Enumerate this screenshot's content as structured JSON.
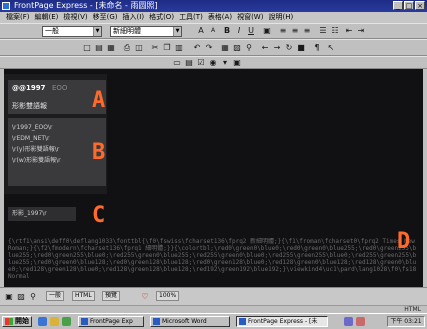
{
  "window": {
    "title": "FrontPage Express - [未命名 - 雨圆照]"
  },
  "menu": [
    "檔案(F)",
    "編輯(E)",
    "檢視(V)",
    "移至(G)",
    "插入(I)",
    "格式(O)",
    "工具(T)",
    "表格(A)",
    "視窗(W)",
    "說明(H)"
  ],
  "toolbar": {
    "style_value": "一般",
    "font_value": "新細明體"
  },
  "panel": {
    "box_a": {
      "header": "@@1997",
      "header2": "EOO",
      "subtitle": "形影雙語報"
    },
    "box_b": {
      "lines": [
        "\\r1997_EOO\\r",
        "\\rEDM_NET\\r",
        "\\r(y)形影雙語報\\r",
        "\\r(w)形影雙語報\\r"
      ]
    },
    "box_c": {
      "text": "形影_1997\\r"
    }
  },
  "callouts": {
    "a": "A",
    "b": "B",
    "c": "C",
    "d": "D"
  },
  "code_text": "{\\rtf1\\ansi\\deff0\\deflang1033\\fonttbl{\\f0\\fswiss\\fcharset136\\fprq2 新細明體;}{\\f1\\froman\\fcharset0\\fprq2 Times New Roman;}{\\f2\\fmodern\\fcharset136\\fprq1 細明體;}}{\\colortbl;\\red0\\green0\\blue0;\\red0\\green0\\blue255;\\red0\\green255\\blue255;\\red0\\green255\\blue0;\\red255\\green0\\blue255;\\red255\\green0\\blue0;\\red255\\green255\\blue0;\\red255\\green255\\blue255;\\red0\\green0\\blue128;\\red0\\green128\\blue128;\\red0\\green128\\blue0;\\red128\\green0\\blue128;\\red128\\green0\\blue0;\\red128\\green128\\blue0;\\red128\\green128\\blue128;\\red192\\green192\\blue192;}\\viewkind4\\uc1\\pard\\lang1028\\f0\\fs18 Normal",
  "bottombar": {
    "tabs": [
      "一般",
      "HTML",
      "預覽"
    ],
    "zoom_label": "100%"
  },
  "status": {
    "text": "",
    "right": "HTML"
  },
  "taskbar": {
    "start_label": "開始",
    "tasks": [
      "FrontPage Exp",
      "Microsoft Word",
      "FrontPage Express - [未"
    ],
    "clock": "下午 03:21"
  },
  "colors": {
    "accent_orange": "#ff6a2a",
    "editor_bg": "#111114",
    "title_blue": "#1e2c86"
  }
}
